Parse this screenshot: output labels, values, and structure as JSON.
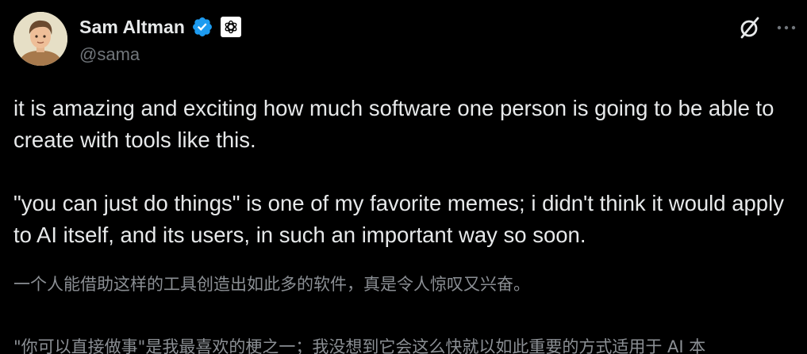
{
  "author": {
    "display_name": "Sam Altman",
    "handle": "@sama",
    "verified": true,
    "affiliation_badge": "openai-logo-icon"
  },
  "actions": {
    "grok_icon": "grok-icon",
    "more_icon": "more-options-icon"
  },
  "tweet": {
    "paragraph_1": "it is amazing and exciting how much software one person is going to be able to create with tools like this.",
    "paragraph_2": "\"you can just do things\" is one of my favorite memes; i didn't think it would apply to AI itself, and its users, in such an important way so soon."
  },
  "translation": {
    "line_1": "一个人能借助这样的工具创造出如此多的软件，真是令人惊叹又兴奋。",
    "line_2": "\"你可以直接做事\"是我最喜欢的梗之一；我没想到它会这么快就以如此重要的方式适用于 AI 本"
  },
  "colors": {
    "background": "#000000",
    "primary_text": "#e7e9ea",
    "secondary_text": "#71767b",
    "verified_blue": "#1d9bf0"
  }
}
